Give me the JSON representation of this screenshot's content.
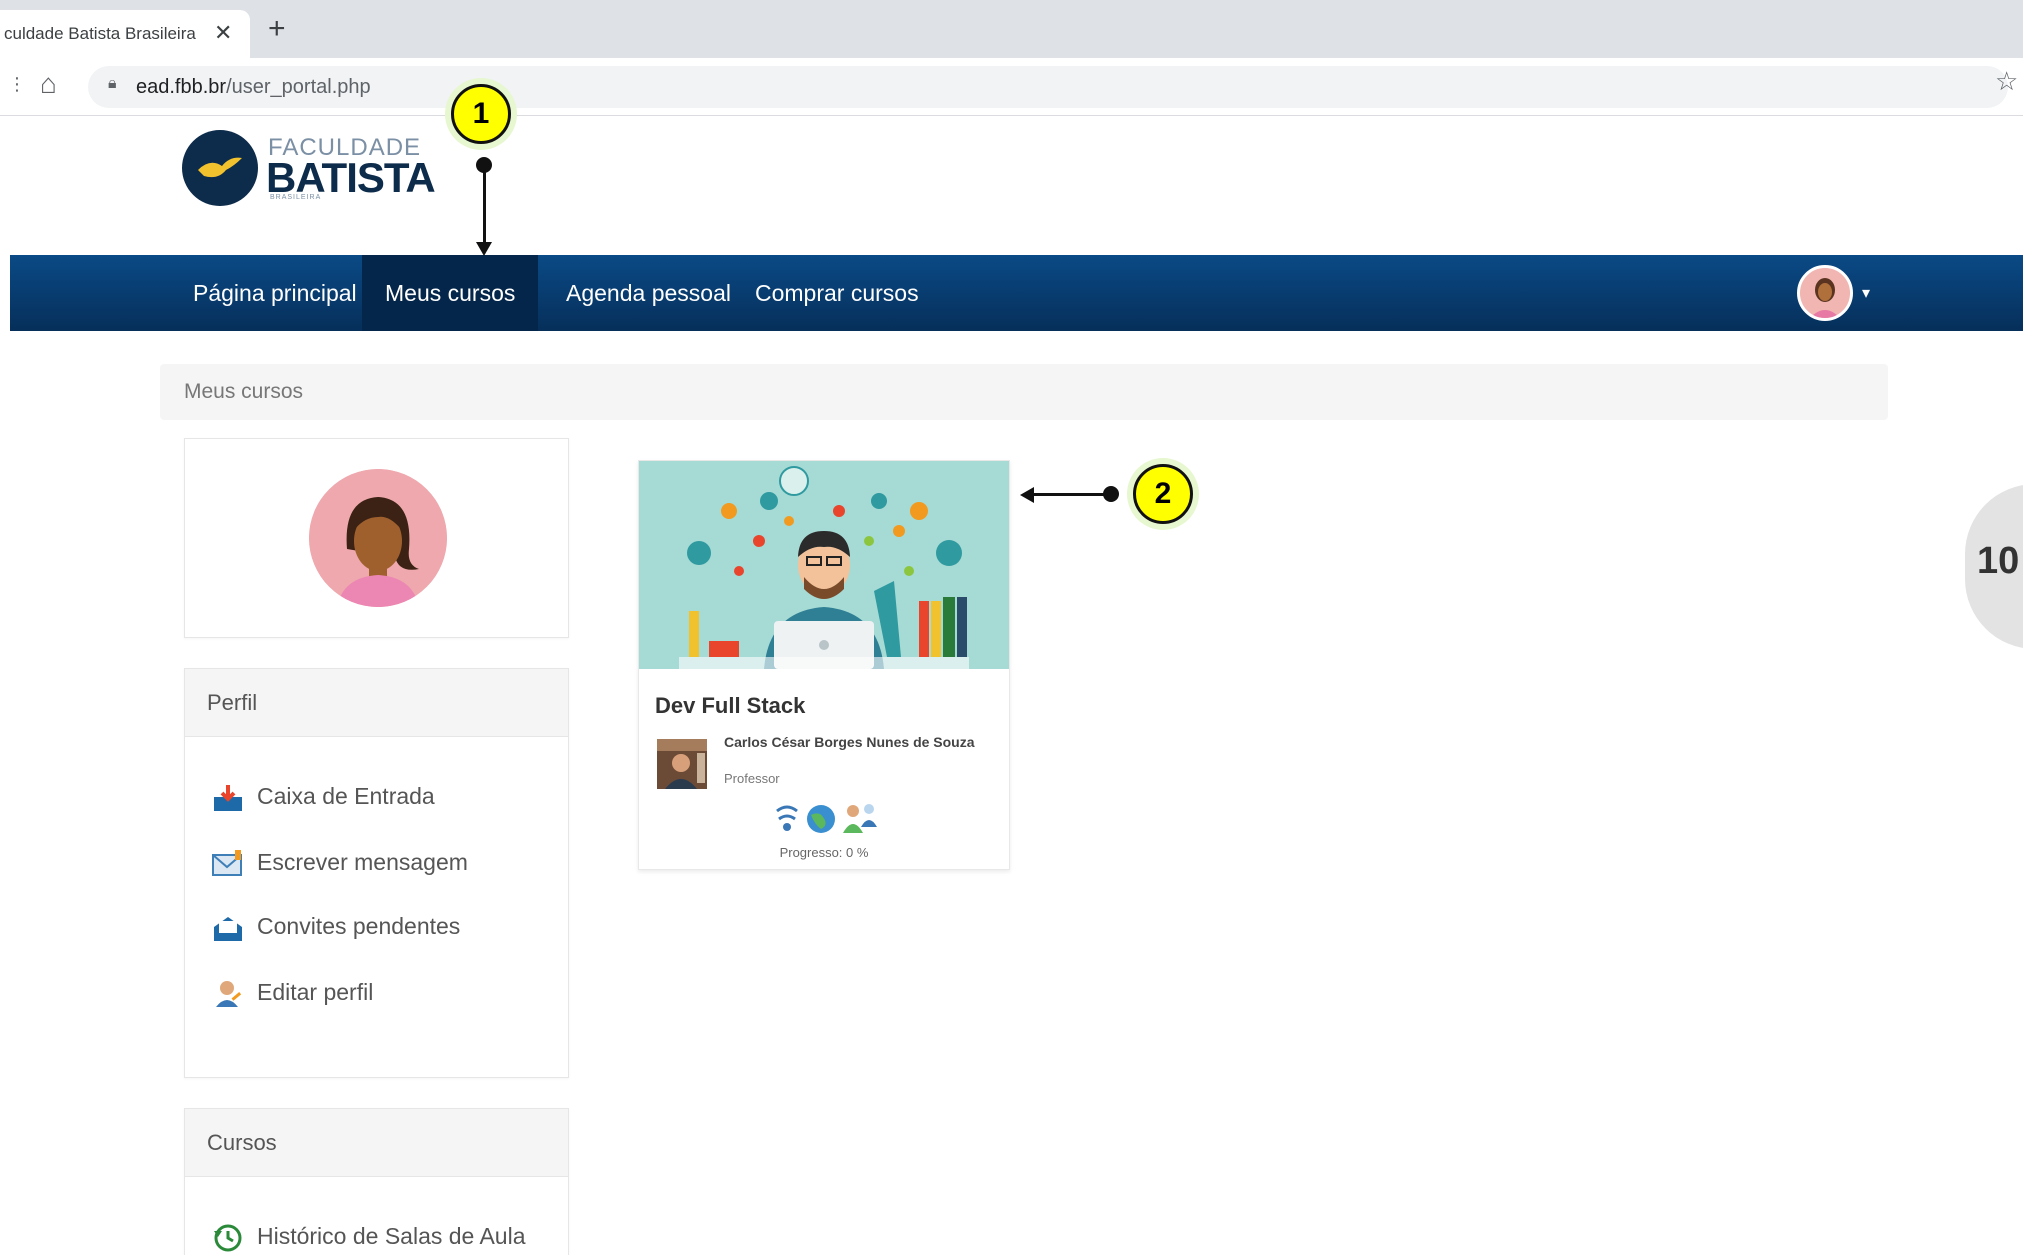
{
  "browser": {
    "tab_title": "culdade Batista Brasileira",
    "tab_close": "✕",
    "new_tab": "+",
    "nav_more": "⋮",
    "url_domain": "ead.fbb.br",
    "url_path": "/user_portal.php"
  },
  "logo": {
    "line1": "FACULDADE",
    "line2": "BATISTA",
    "line3": "BRASILEIRA"
  },
  "navbar": {
    "items": [
      {
        "label": "Página principal",
        "active": false
      },
      {
        "label": "Meus cursos",
        "active": true
      },
      {
        "label": "Agenda pessoal",
        "active": false
      },
      {
        "label": "Comprar cursos",
        "active": false
      }
    ],
    "caret": "▾"
  },
  "breadcrumb": {
    "label": "Meus cursos"
  },
  "sidebar": {
    "profile_panel": {
      "heading": "Perfil",
      "items": [
        {
          "label": "Caixa de Entrada",
          "icon": "inbox-icon"
        },
        {
          "label": "Escrever mensagem",
          "icon": "compose-message-icon"
        },
        {
          "label": "Convites pendentes",
          "icon": "pending-invites-icon"
        },
        {
          "label": "Editar perfil",
          "icon": "edit-profile-icon"
        }
      ]
    },
    "courses_panel": {
      "heading": "Cursos",
      "items": [
        {
          "label": "Histórico de Salas de Aula",
          "icon": "history-icon"
        }
      ]
    }
  },
  "course_card": {
    "title": "Dev Full Stack",
    "teacher_name": "Carlos César Borges Nunes de Souza",
    "teacher_role": "Professor",
    "progress_label": "Progresso: 0 %",
    "progress_value": 0
  },
  "annotations": {
    "callout1": "1",
    "callout2": "2",
    "page_number": "10"
  },
  "colors": {
    "navbar": "#0a4a86",
    "navbar_active": "#04264a",
    "callout": "#ffff00",
    "card_image_bg": "#a6dad4"
  }
}
